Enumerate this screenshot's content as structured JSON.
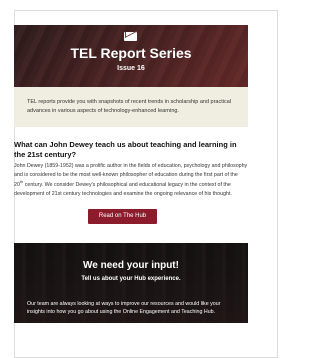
{
  "header": {
    "icon": "mail-icon",
    "title": "TEL Report Series",
    "issue": "Issue 16"
  },
  "intro": {
    "text": "TEL reports provide you with snapshots of recent trends in scholarship and practical advances in various aspects of technology-enhanced learning."
  },
  "article": {
    "title": "What can John Dewey teach us about teaching and learning in the 21st century?",
    "body_part1": "John Dewey (1859-1952) was a prolific author in the fields of education, psychology and philosophy and is considered to be the most well-known philosopher of education during the first part of the 20",
    "body_sup": "th",
    "body_part2": " century. We consider Dewey's philosophical and educational legacy in the context of the development of 21st century technologies and examine the ongoing relevance of his thought.",
    "cta_label": "Read on The Hub"
  },
  "feedback": {
    "heading": "We need your input!",
    "subheading": "Tell us about your Hub experience.",
    "body": "Our team are always looking at ways to improve our resources and would like your insights into how you go about using the Online Engagement and Teaching Hub."
  },
  "colors": {
    "accent": "#8c1b2b",
    "intro_bg": "#efeee0"
  }
}
